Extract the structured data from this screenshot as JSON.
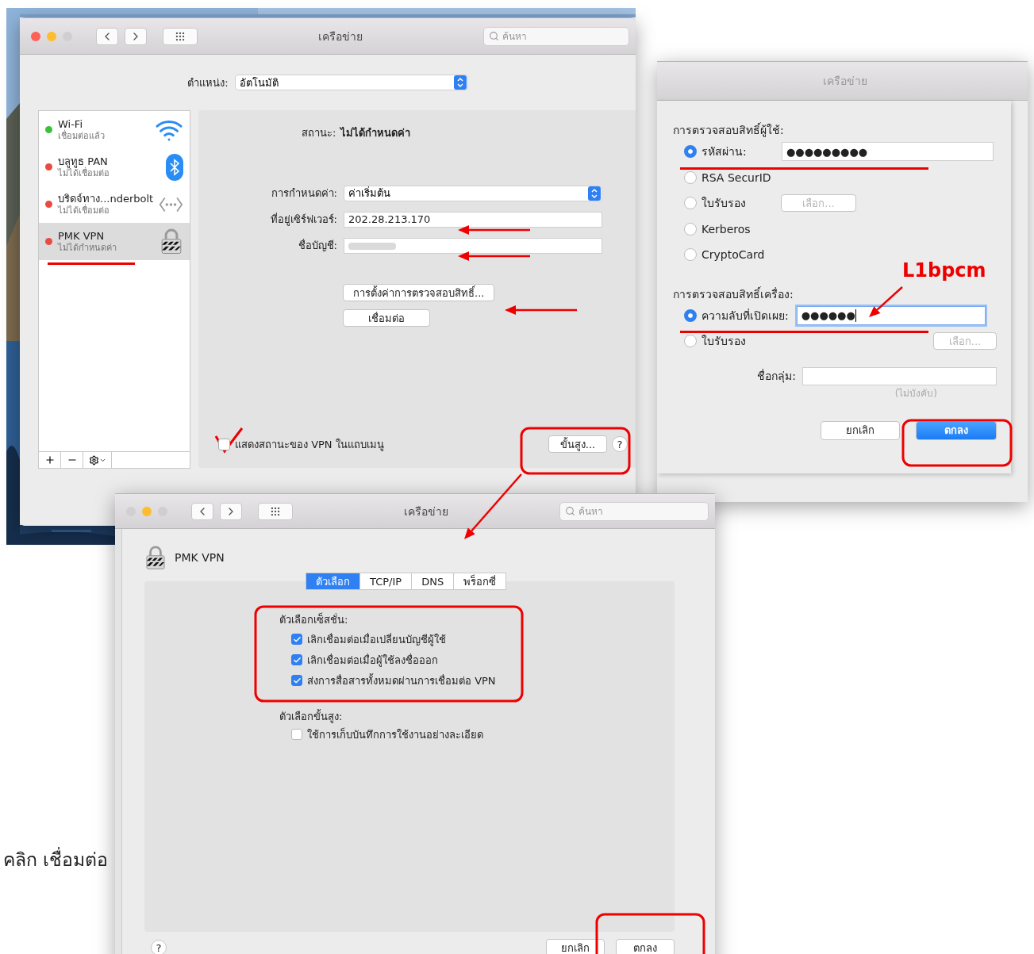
{
  "main_window": {
    "title": "เครือข่าย",
    "search_placeholder": "ค้นหา",
    "location_label": "ตำแหน่ง:",
    "location_value": "อัตโนมัติ",
    "services": [
      {
        "name": "Wi-Fi",
        "status": "เชื่อมต่อแล้ว",
        "color": "#3cc13c",
        "kind": "wifi",
        "selected": false
      },
      {
        "name": "บลูทูธ PAN",
        "status": "ไม่ได้เชื่อมต่อ",
        "color": "#e94b43",
        "kind": "bluetooth",
        "selected": false
      },
      {
        "name": "บริดจ์ทาง...nderbolt",
        "status": "ไม่ได้เชื่อมต่อ",
        "color": "#e94b43",
        "kind": "bridge",
        "selected": false
      },
      {
        "name": "PMK VPN",
        "status": "ไม่ได้กำหนดค่า",
        "color": "#e94b43",
        "kind": "vpn",
        "selected": true
      }
    ],
    "status_label": "สถานะ:",
    "status_value": "ไม่ได้กำหนดค่า",
    "fields": [
      {
        "label": "การกำหนดค่า:",
        "value": "ค่าเริ่มต้น",
        "kind": "popup"
      },
      {
        "label": "ที่อยู่เซิร์ฟเวอร์:",
        "value": "202.28.213.170",
        "kind": "text"
      },
      {
        "label": "ชื่อบัญชี:",
        "kind": "blurred"
      }
    ],
    "auth_button": "การตั้งค่าการตรวจสอบสิทธิ์...",
    "connect_button": "เชื่อมต่อ",
    "show_status": {
      "label": "แสดงสถานะของ VPN ในแถบเมนู",
      "checked": false
    },
    "advanced_button": "ขั้นสูง...",
    "help": "?"
  },
  "auth_dialog": {
    "title": "เครือข่าย",
    "user_auth_label": "การตรวจสอบสิทธิ์ผู้ใช้:",
    "user_methods": [
      {
        "label": "รหัสผ่าน:",
        "kind": "field",
        "value": "●●●●●●●●●",
        "selected": true
      },
      {
        "label": "RSA SecurID",
        "kind": "plain",
        "selected": false
      },
      {
        "label": "ใบรับรอง",
        "kind": "choose",
        "button": "เลือก...",
        "selected": false
      },
      {
        "label": "Kerberos",
        "kind": "plain",
        "selected": false
      },
      {
        "label": "CryptoCard",
        "kind": "plain",
        "selected": false
      }
    ],
    "machine_auth_label": "การตรวจสอบสิทธิ์เครื่อง:",
    "machine_methods": [
      {
        "label": "ความลับที่เปิดเผย:",
        "kind": "field",
        "value": "●●●●●●",
        "focused": true,
        "selected": true
      },
      {
        "label": "ใบรับรอง",
        "kind": "choose_right",
        "button": "เลือก...",
        "selected": false
      }
    ],
    "group_label": "ชื่อกลุ่ม:",
    "group_hint": "(ไม่บังคับ)",
    "cancel": "ยกเลิก",
    "ok": "ตกลง"
  },
  "options_window": {
    "title": "เครือข่าย",
    "search_placeholder": "ค้นหา",
    "service_name": "PMK VPN",
    "tabs": [
      {
        "label": "ตัวเลือก",
        "selected": true
      },
      {
        "label": "TCP/IP",
        "selected": false
      },
      {
        "label": "DNS",
        "selected": false
      },
      {
        "label": "พร็อกซี่",
        "selected": false
      }
    ],
    "session_label": "ตัวเลือกเซ็สชั่น:",
    "session_options": [
      {
        "label": "เลิกเชื่อมต่อเมื่อเปลี่ยนบัญชีผู้ใช้",
        "checked": true
      },
      {
        "label": "เลิกเชื่อมต่อเมื่อผู้ใช้ลงชื่อออก",
        "checked": true
      },
      {
        "label": "ส่งการสื่อสารทั้งหมดผ่านการเชื่อมต่อ VPN",
        "checked": true
      }
    ],
    "advanced_label": "ตัวเลือกขั้นสูง:",
    "advanced_options": [
      {
        "label": "ใช้การเก็บบันทึกการใช้งานอย่างละเอียด",
        "checked": false
      }
    ],
    "help": "?",
    "cancel": "ยกเลิก",
    "ok": "ตกลง"
  },
  "annotation_note": "L1bpcm",
  "caption": "คลิก เชื่อมต่อ"
}
